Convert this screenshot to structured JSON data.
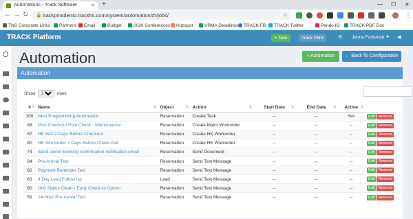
{
  "browser": {
    "tab_title": "Automations - Track Software",
    "url": "trackpmsdemo.trackhs.com/system/automation/#!/jobs/",
    "bookmarks": [
      "TNS Corporate Links",
      "Partners",
      "Email",
      "Budget",
      "2020 Conferences",
      "Hubspot",
      "VRMA Deadlines",
      "TRACK FB",
      "TRACK Twitter",
      "Pendo.IO",
      "TRACK PDF Doc"
    ]
  },
  "topnav": {
    "brand": "TRACK Platform",
    "task_button": "+ Task",
    "pms_button": "Track PMS",
    "user": "Jenna Furfeman"
  },
  "page": {
    "title": "Automation",
    "add_button": "+ Automation",
    "back_button": "← Back To Configuration"
  },
  "panel": {
    "title": "Automation",
    "show_label": "Show",
    "entries_value": "10",
    "rows_label": "rows"
  },
  "table": {
    "headers": [
      "#",
      "Name",
      "Object",
      "Action",
      "Start Date",
      "End Date",
      "Active"
    ],
    "edit_label": "Edit",
    "remove_label": "Remove",
    "rows": [
      {
        "id": "100",
        "name": "Nest Programming Automation",
        "object": "Reservation",
        "action": "Create Task",
        "start": "--",
        "end": "--",
        "active": "Yes"
      },
      {
        "id": "88",
        "name": "Post Checkout Pool Check - Maintenance",
        "object": "Reservation",
        "action": "Create Maint Workorder",
        "start": "--",
        "end": "--",
        "active": "--"
      },
      {
        "id": "87",
        "name": "HK WO 2-Days Before Checkout",
        "object": "Reservation",
        "action": "Create HK Workorder",
        "start": "--",
        "end": "--",
        "active": "--"
      },
      {
        "id": "80",
        "name": "HK Workorder 7 Days Before Check-Out",
        "object": "Reservation",
        "action": "Create HK Workorder",
        "start": "--",
        "end": "--",
        "active": "--"
      },
      {
        "id": "74",
        "name": "Send owner booking confirmation notification email",
        "object": "Reservation",
        "action": "Send Document",
        "start": "--",
        "end": "--",
        "active": "--"
      },
      {
        "id": "64",
        "name": "Pre-Arrival Text",
        "object": "Reservation",
        "action": "Send Text Message",
        "start": "--",
        "end": "--",
        "active": "--"
      },
      {
        "id": "62",
        "name": "Payment Reminder Text",
        "object": "Reservation",
        "action": "Send Text Message",
        "start": "--",
        "end": "--",
        "active": "--"
      },
      {
        "id": "63",
        "name": "4 Day Lead Follow Up",
        "object": "Lead",
        "action": "Send Text Message",
        "start": "--",
        "end": "--",
        "active": "--"
      },
      {
        "id": "60",
        "name": "Unit Status Clean - Early Check-In Option",
        "object": "Reservation",
        "action": "Send Text Message",
        "start": "--",
        "end": "--",
        "active": "--"
      },
      {
        "id": "59",
        "name": "24-Hour Pre-Arrival Text",
        "object": "Reservation",
        "action": "Send Text Message",
        "start": "--",
        "end": "--",
        "active": "--"
      }
    ]
  }
}
